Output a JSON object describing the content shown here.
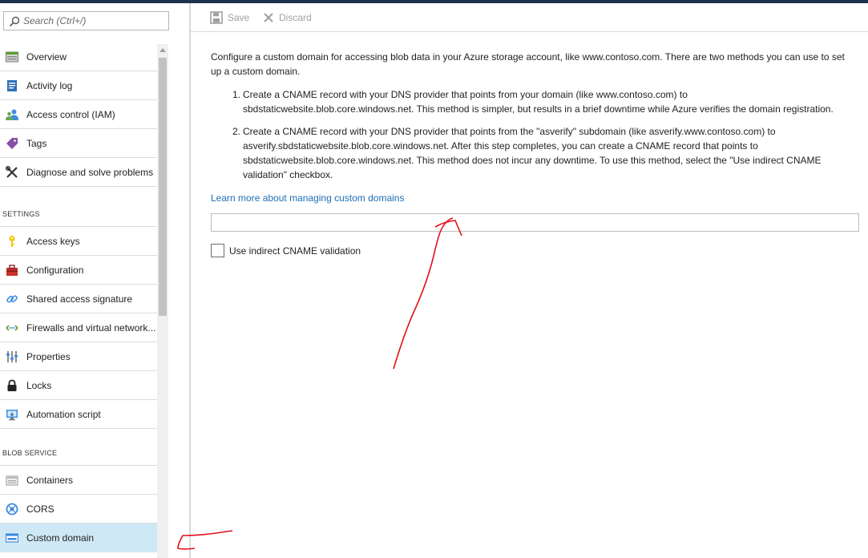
{
  "colors": {
    "accent_link": "#1e6fb8",
    "selected_bg": "#cfe8f6",
    "topbar": "#1b3350",
    "annotation": "#e0101a"
  },
  "search": {
    "placeholder": "Search (Ctrl+/)",
    "icon": "search-icon"
  },
  "sidebar": {
    "items": [
      {
        "label": "Overview",
        "icon": "overview-icon"
      },
      {
        "label": "Activity log",
        "icon": "activity-log-icon"
      },
      {
        "label": "Access control (IAM)",
        "icon": "people-icon"
      },
      {
        "label": "Tags",
        "icon": "tag-icon"
      },
      {
        "label": "Diagnose and solve problems",
        "icon": "wrench-icon"
      }
    ],
    "settings_header": "SETTINGS",
    "settings_items": [
      {
        "label": "Access keys",
        "icon": "key-icon"
      },
      {
        "label": "Configuration",
        "icon": "toolbox-icon"
      },
      {
        "label": "Shared access signature",
        "icon": "link-icon"
      },
      {
        "label": "Firewalls and virtual network...",
        "icon": "firewall-icon"
      },
      {
        "label": "Properties",
        "icon": "properties-icon"
      },
      {
        "label": "Locks",
        "icon": "lock-icon"
      },
      {
        "label": "Automation script",
        "icon": "automation-icon"
      }
    ],
    "blob_header": "BLOB SERVICE",
    "blob_items": [
      {
        "label": "Containers",
        "icon": "container-icon"
      },
      {
        "label": "CORS",
        "icon": "cors-icon"
      },
      {
        "label": "Custom domain",
        "icon": "custom-domain-icon",
        "selected": true
      }
    ]
  },
  "toolbar": {
    "save_label": "Save",
    "discard_label": "Discard"
  },
  "main": {
    "intro": "Configure a custom domain for accessing blob data in your Azure storage account, like www.contoso.com. There are two methods you can use to set up a custom domain.",
    "steps": [
      {
        "num": "1.",
        "text": "Create a CNAME record with your DNS provider that points from your domain (like www.contoso.com) to sbdstaticwebsite.blob.core.windows.net. This method is simpler, but results in a brief downtime while Azure verifies the domain registration."
      },
      {
        "num": "2.",
        "text": "Create a CNAME record with your DNS provider that points from the \"asverify\" subdomain (like asverify.www.contoso.com) to asverify.sbdstaticwebsite.blob.core.windows.net. After this step completes, you can create a CNAME record that points to sbdstaticwebsite.blob.core.windows.net. This method does not incur any downtime. To use this method, select the \"Use indirect CNAME validation\" checkbox."
      }
    ],
    "learn_more": "Learn more about managing custom domains",
    "domain_value": "",
    "checkbox_label": "Use indirect CNAME validation",
    "checkbox_checked": false
  }
}
